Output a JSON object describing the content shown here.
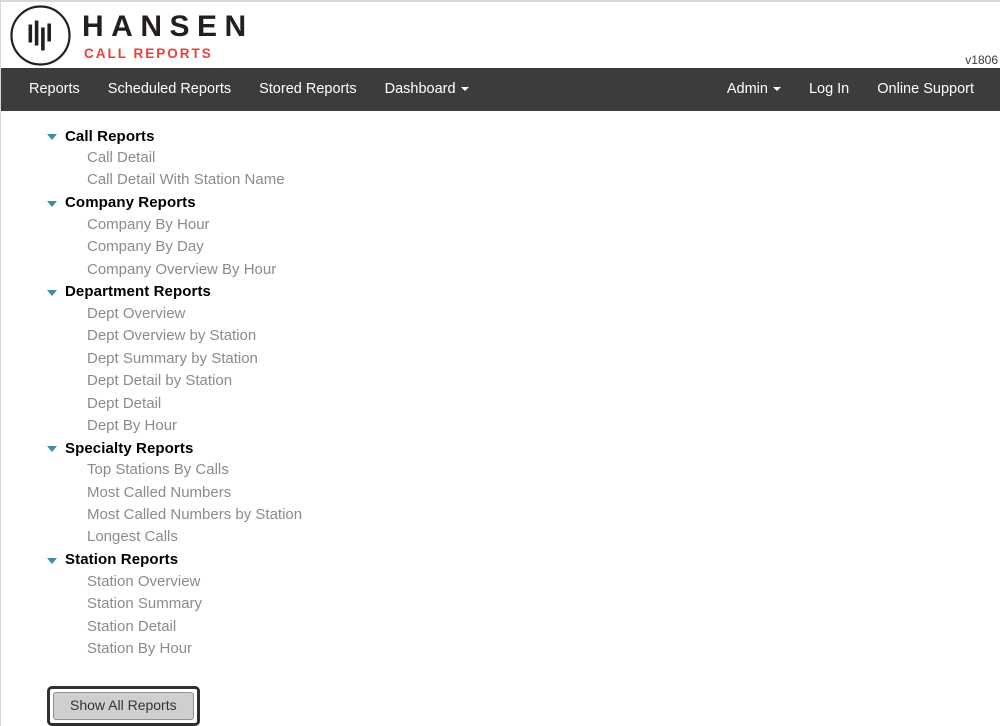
{
  "brand": {
    "title": "HANSEN",
    "subtitle": "CALL REPORTS",
    "logo_icon": "hansen-circle-bars-logo",
    "accent_red": "#ed3e37",
    "text_dark": "#231f20"
  },
  "version_label": "v1806",
  "navbar": {
    "background": "#3d3c3b",
    "left_items": [
      {
        "label": "Reports",
        "has_caret": false
      },
      {
        "label": "Scheduled Reports",
        "has_caret": false
      },
      {
        "label": "Stored Reports",
        "has_caret": false
      },
      {
        "label": "Dashboard",
        "has_caret": true
      }
    ],
    "right_items": [
      {
        "label": "Admin",
        "has_caret": true
      },
      {
        "label": "Log In",
        "has_caret": false
      },
      {
        "label": "Online Support",
        "has_caret": false
      }
    ]
  },
  "tree": {
    "expand_icon": "triangle-down-icon",
    "expand_icon_color": "#3f8da3",
    "header_color": "#000000",
    "child_color": "#8b8b8b",
    "groups": [
      {
        "label": "Call Reports",
        "expanded": true,
        "children": [
          "Call Detail",
          "Call Detail With Station Name"
        ]
      },
      {
        "label": "Company Reports",
        "expanded": true,
        "children": [
          "Company By Hour",
          "Company By Day",
          "Company Overview By Hour"
        ]
      },
      {
        "label": "Department Reports",
        "expanded": true,
        "children": [
          "Dept Overview",
          "Dept Overview by Station",
          "Dept Summary by Station",
          "Dept Detail by Station",
          "Dept Detail",
          "Dept By Hour"
        ]
      },
      {
        "label": "Specialty Reports",
        "expanded": true,
        "children": [
          "Top Stations By Calls",
          "Most Called Numbers",
          "Most Called Numbers by Station",
          "Longest Calls"
        ]
      },
      {
        "label": "Station Reports",
        "expanded": true,
        "children": [
          "Station Overview",
          "Station Summary",
          "Station Detail",
          "Station By Hour"
        ]
      }
    ]
  },
  "footer_button": {
    "label": "Show All Reports",
    "focused": true
  }
}
